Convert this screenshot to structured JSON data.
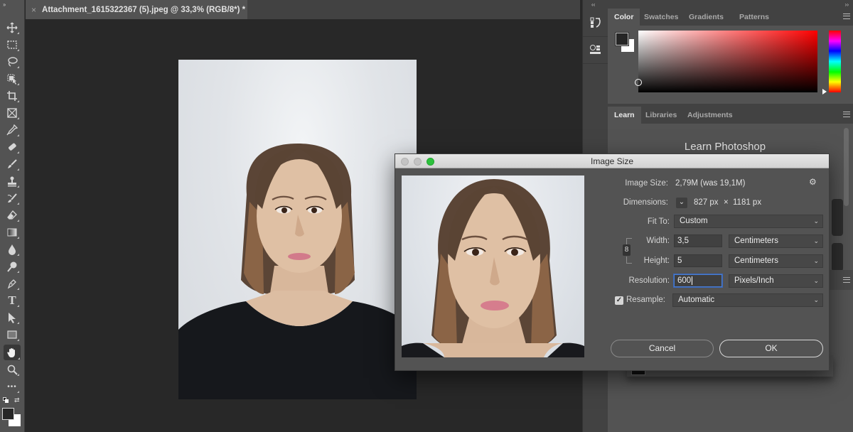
{
  "document": {
    "tab_title": "Attachment_1615322367 (5).jpeg @ 33,3% (RGB/8*) *",
    "close_glyph": "×"
  },
  "toolbar": {
    "tools": [
      {
        "name": "move-tool",
        "icon": "move-icon"
      },
      {
        "name": "rectangular-marquee-tool",
        "icon": "marquee-icon"
      },
      {
        "name": "lasso-tool",
        "icon": "lasso-icon"
      },
      {
        "name": "object-selection-tool",
        "icon": "object-selection-icon"
      },
      {
        "name": "crop-tool",
        "icon": "crop-icon"
      },
      {
        "name": "frame-tool",
        "icon": "frame-icon"
      },
      {
        "name": "eyedropper-tool",
        "icon": "eyedropper-icon"
      },
      {
        "name": "spot-healing-tool",
        "icon": "bandage-icon"
      },
      {
        "name": "brush-tool",
        "icon": "brush-icon"
      },
      {
        "name": "clone-stamp-tool",
        "icon": "stamp-icon"
      },
      {
        "name": "history-brush-tool",
        "icon": "history-brush-icon"
      },
      {
        "name": "eraser-tool",
        "icon": "eraser-icon"
      },
      {
        "name": "gradient-tool",
        "icon": "gradient-icon"
      },
      {
        "name": "blur-tool",
        "icon": "drop-icon"
      },
      {
        "name": "dodge-tool",
        "icon": "dodge-icon"
      },
      {
        "name": "pen-tool",
        "icon": "pen-icon"
      },
      {
        "name": "type-tool",
        "icon": "type-icon"
      },
      {
        "name": "path-selection-tool",
        "icon": "arrow-icon"
      },
      {
        "name": "rectangle-tool",
        "icon": "rectangle-icon"
      },
      {
        "name": "hand-tool",
        "icon": "hand-icon",
        "active": true
      },
      {
        "name": "zoom-tool",
        "icon": "magnifier-icon"
      },
      {
        "name": "edit-toolbar",
        "icon": "more-icon"
      }
    ],
    "type_glyph": "T",
    "more_glyph": "•••",
    "foreground_color": "#262626",
    "background_color": "#ffffff"
  },
  "panels": {
    "color": {
      "tabs": [
        "Color",
        "Swatches",
        "Gradients",
        "Patterns"
      ],
      "active_tab": "Color",
      "foreground": "#262626",
      "background": "#ffffff",
      "hue": "#ff0000"
    },
    "learn": {
      "tabs": [
        "Learn",
        "Libraries",
        "Adjustments"
      ],
      "active_tab": "Learn",
      "title": "Learn Photoshop"
    }
  },
  "dialog": {
    "title": "Image Size",
    "image_size_label": "Image Size:",
    "image_size_value": "2,79M (was 19,1M)",
    "dimensions_label": "Dimensions:",
    "dimensions_width": "827 px",
    "dimensions_times": "×",
    "dimensions_height": "1181 px",
    "fit_to_label": "Fit To:",
    "fit_to_value": "Custom",
    "width_label": "Width:",
    "width_value": "3,5",
    "width_unit": "Centimeters",
    "height_label": "Height:",
    "height_value": "5",
    "height_unit": "Centimeters",
    "resolution_label": "Resolution:",
    "resolution_value": "600",
    "resolution_unit": "Pixels/Inch",
    "resample_label": "Resample:",
    "resample_checked": true,
    "resample_value": "Automatic",
    "cancel_label": "Cancel",
    "ok_label": "OK",
    "chevron_glyph": "⌄",
    "check_glyph": "✓",
    "gear_glyph": "⚙",
    "link_glyph": "8"
  }
}
